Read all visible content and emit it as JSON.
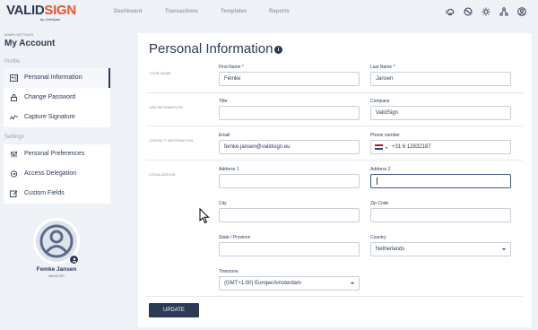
{
  "brand": {
    "name_part1": "VALID",
    "name_part2": "SIGN",
    "tagline": "by OneSpan",
    "accent": "#e4572e",
    "primary": "#2b3a55"
  },
  "nav": [
    "Dashboard",
    "Transactions",
    "Templates",
    "Reports"
  ],
  "top_icons": [
    "cloud-icon",
    "globe-icon",
    "sun-icon",
    "network-icon",
    "user-circle-icon"
  ],
  "sidebar": {
    "admin_label": "ADMIN SETTINGS",
    "title": "My Account",
    "sections": [
      {
        "label": "Profile",
        "items": [
          {
            "label": "Personal Information",
            "icon": "id-card-icon",
            "active": true
          },
          {
            "label": "Change Password",
            "icon": "lock-icon",
            "active": false
          },
          {
            "label": "Capture Signature",
            "icon": "signature-icon",
            "active": false
          }
        ]
      },
      {
        "label": "Settings",
        "items": [
          {
            "label": "Personal Preferences",
            "icon": "sliders-icon",
            "active": false
          },
          {
            "label": "Access Delegation",
            "icon": "delegation-icon",
            "active": false
          },
          {
            "label": "Custom Fields",
            "icon": "edit-icon",
            "active": false
          }
        ]
      }
    ],
    "user": {
      "name": "Femke Jansen",
      "role": "MANAGER"
    }
  },
  "main": {
    "title": "Personal Information",
    "sections": {
      "name": "YOUR NAME",
      "job": "JOB INFORMATION",
      "contact": "CONTACT INFORMATION",
      "localization": "LOCALIZATION"
    },
    "fields": {
      "first_name": {
        "label": "First Name *",
        "value": "Femke"
      },
      "last_name": {
        "label": "Last Name *",
        "value": "Jansen"
      },
      "title": {
        "label": "Title",
        "value": ""
      },
      "company": {
        "label": "Company",
        "value": "ValidSign"
      },
      "email": {
        "label": "Email",
        "value": "femke.jansen@validsign.eu"
      },
      "phone": {
        "label": "Phone number",
        "value": "+31 6 12832187",
        "country_flag": "NL"
      },
      "address1": {
        "label": "Address 1",
        "value": ""
      },
      "address2": {
        "label": "Address 2",
        "value": ""
      },
      "city": {
        "label": "City",
        "value": ""
      },
      "zip": {
        "label": "Zip Code",
        "value": ""
      },
      "state": {
        "label": "State / Province",
        "value": ""
      },
      "country": {
        "label": "Country",
        "value": "Netherlands"
      },
      "timezone": {
        "label": "Timezone",
        "value": "(GMT+1:00) Europe/Amsterdam"
      }
    },
    "update_label": "UPDATE"
  }
}
